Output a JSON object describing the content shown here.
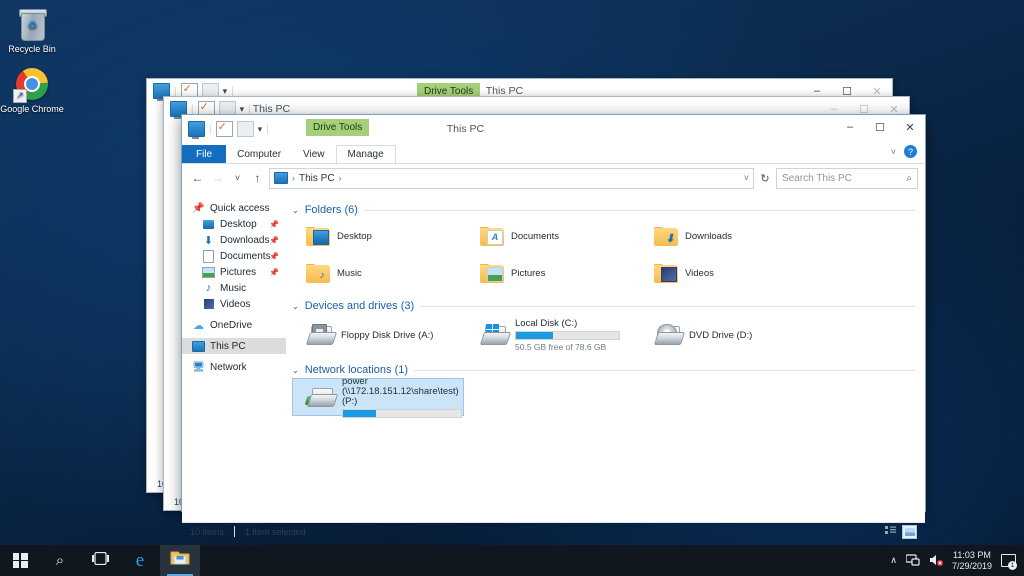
{
  "desktop": {
    "icons": [
      {
        "label": "Recycle Bin",
        "icon": "recycle-bin-icon"
      },
      {
        "label": "Google Chrome",
        "icon": "google-chrome-icon"
      }
    ]
  },
  "windows": [
    {
      "id": "back",
      "title": "This PC",
      "context_tab": "Drive Tools",
      "status_text": "10",
      "controls": {
        "minimize": "‒",
        "maximize": "☐",
        "close": "✕"
      }
    },
    {
      "id": "middle",
      "title": "This PC",
      "status_text": "10",
      "controls": {
        "minimize": "‒",
        "maximize": "☐",
        "close": "✕"
      }
    }
  ],
  "active_window": {
    "title": "This PC",
    "context_tab_group": "Drive Tools",
    "quick_access": [
      "this-pc-icon",
      "properties-icon",
      "new-folder-icon",
      "customize-dropdown-icon"
    ],
    "controls": {
      "minimize": "‒",
      "maximize": "☐",
      "close": "✕"
    },
    "help": {
      "chevron": "˅",
      "question": "?"
    },
    "ribbon_tabs": [
      {
        "label": "File",
        "type": "file"
      },
      {
        "label": "Computer",
        "type": "normal"
      },
      {
        "label": "View",
        "type": "normal"
      },
      {
        "label": "Manage",
        "type": "contextual"
      }
    ],
    "address_bar": {
      "back": "←",
      "forward": "→",
      "recent": "˅",
      "up": "↑",
      "crumbs": [
        "This PC"
      ],
      "crumb_sep": "›",
      "dropdown": "˅",
      "refresh": "↻"
    },
    "search": {
      "placeholder": "Search This PC",
      "icon": "⌕"
    },
    "nav_pane": [
      {
        "label": "Quick access",
        "icon": "pin-icon",
        "indent": false,
        "pinned": false,
        "selected": false
      },
      {
        "label": "Desktop",
        "icon": "desktop-icon",
        "indent": true,
        "pinned": true,
        "selected": false
      },
      {
        "label": "Downloads",
        "icon": "downloads-icon",
        "indent": true,
        "pinned": true,
        "selected": false
      },
      {
        "label": "Documents",
        "icon": "documents-icon",
        "indent": true,
        "pinned": true,
        "selected": false
      },
      {
        "label": "Pictures",
        "icon": "pictures-icon",
        "indent": true,
        "pinned": true,
        "selected": false
      },
      {
        "label": "Music",
        "icon": "music-icon",
        "indent": true,
        "pinned": false,
        "selected": false
      },
      {
        "label": "Videos",
        "icon": "videos-icon",
        "indent": true,
        "pinned": false,
        "selected": false
      },
      {
        "label": "OneDrive",
        "icon": "onedrive-icon",
        "indent": false,
        "pinned": false,
        "selected": false
      },
      {
        "label": "This PC",
        "icon": "this-pc-icon",
        "indent": false,
        "pinned": false,
        "selected": true
      },
      {
        "label": "Network",
        "icon": "network-icon",
        "indent": false,
        "pinned": false,
        "selected": false
      }
    ],
    "groups": [
      {
        "header": "Folders (6)",
        "chevron": "⌄",
        "items": [
          {
            "label": "Desktop",
            "icon": "folder-desktop-icon"
          },
          {
            "label": "Documents",
            "icon": "folder-documents-icon"
          },
          {
            "label": "Downloads",
            "icon": "folder-downloads-icon"
          },
          {
            "label": "Music",
            "icon": "folder-music-icon"
          },
          {
            "label": "Pictures",
            "icon": "folder-pictures-icon"
          },
          {
            "label": "Videos",
            "icon": "folder-videos-icon"
          }
        ]
      },
      {
        "header": "Devices and drives (3)",
        "chevron": "⌄",
        "items": [
          {
            "label": "Floppy Disk Drive (A:)",
            "icon": "floppy-drive-icon",
            "has_bar": false
          },
          {
            "label": "Local Disk (C:)",
            "icon": "local-disk-icon",
            "has_bar": true,
            "free_text": "50.5 GB free of 78.6 GB",
            "used_percent": 36
          },
          {
            "label": "DVD Drive (D:)",
            "icon": "dvd-drive-icon",
            "has_bar": false
          }
        ]
      },
      {
        "header": "Network locations (1)",
        "chevron": "⌄",
        "items": [
          {
            "label": "power (\\\\172.18.151.12\\share\\test) (P:)",
            "icon": "network-drive-icon",
            "has_bar": true,
            "used_percent": 28,
            "selected": true
          }
        ]
      }
    ],
    "status_bar": {
      "item_count": "10 items",
      "selection": "1 item selected",
      "views": [
        {
          "name": "details-view-button",
          "active": false
        },
        {
          "name": "large-icons-view-button",
          "active": true
        }
      ]
    }
  },
  "taskbar": {
    "buttons": [
      {
        "name": "start-button",
        "icon": "windows-logo-icon"
      },
      {
        "name": "search-button",
        "icon": "search-icon",
        "glyph": "⌕"
      },
      {
        "name": "task-view-button",
        "icon": "task-view-icon"
      },
      {
        "name": "edge-button",
        "icon": "edge-icon",
        "glyph": "e"
      },
      {
        "name": "file-explorer-button",
        "icon": "file-explorer-icon",
        "running": true
      }
    ],
    "tray": {
      "expand": "∧",
      "network_icon": "network-tray-icon",
      "volume_icon": "volume-muted-icon",
      "time": "11:03 PM",
      "date": "7/29/2019",
      "action_center_badge": "1"
    }
  }
}
